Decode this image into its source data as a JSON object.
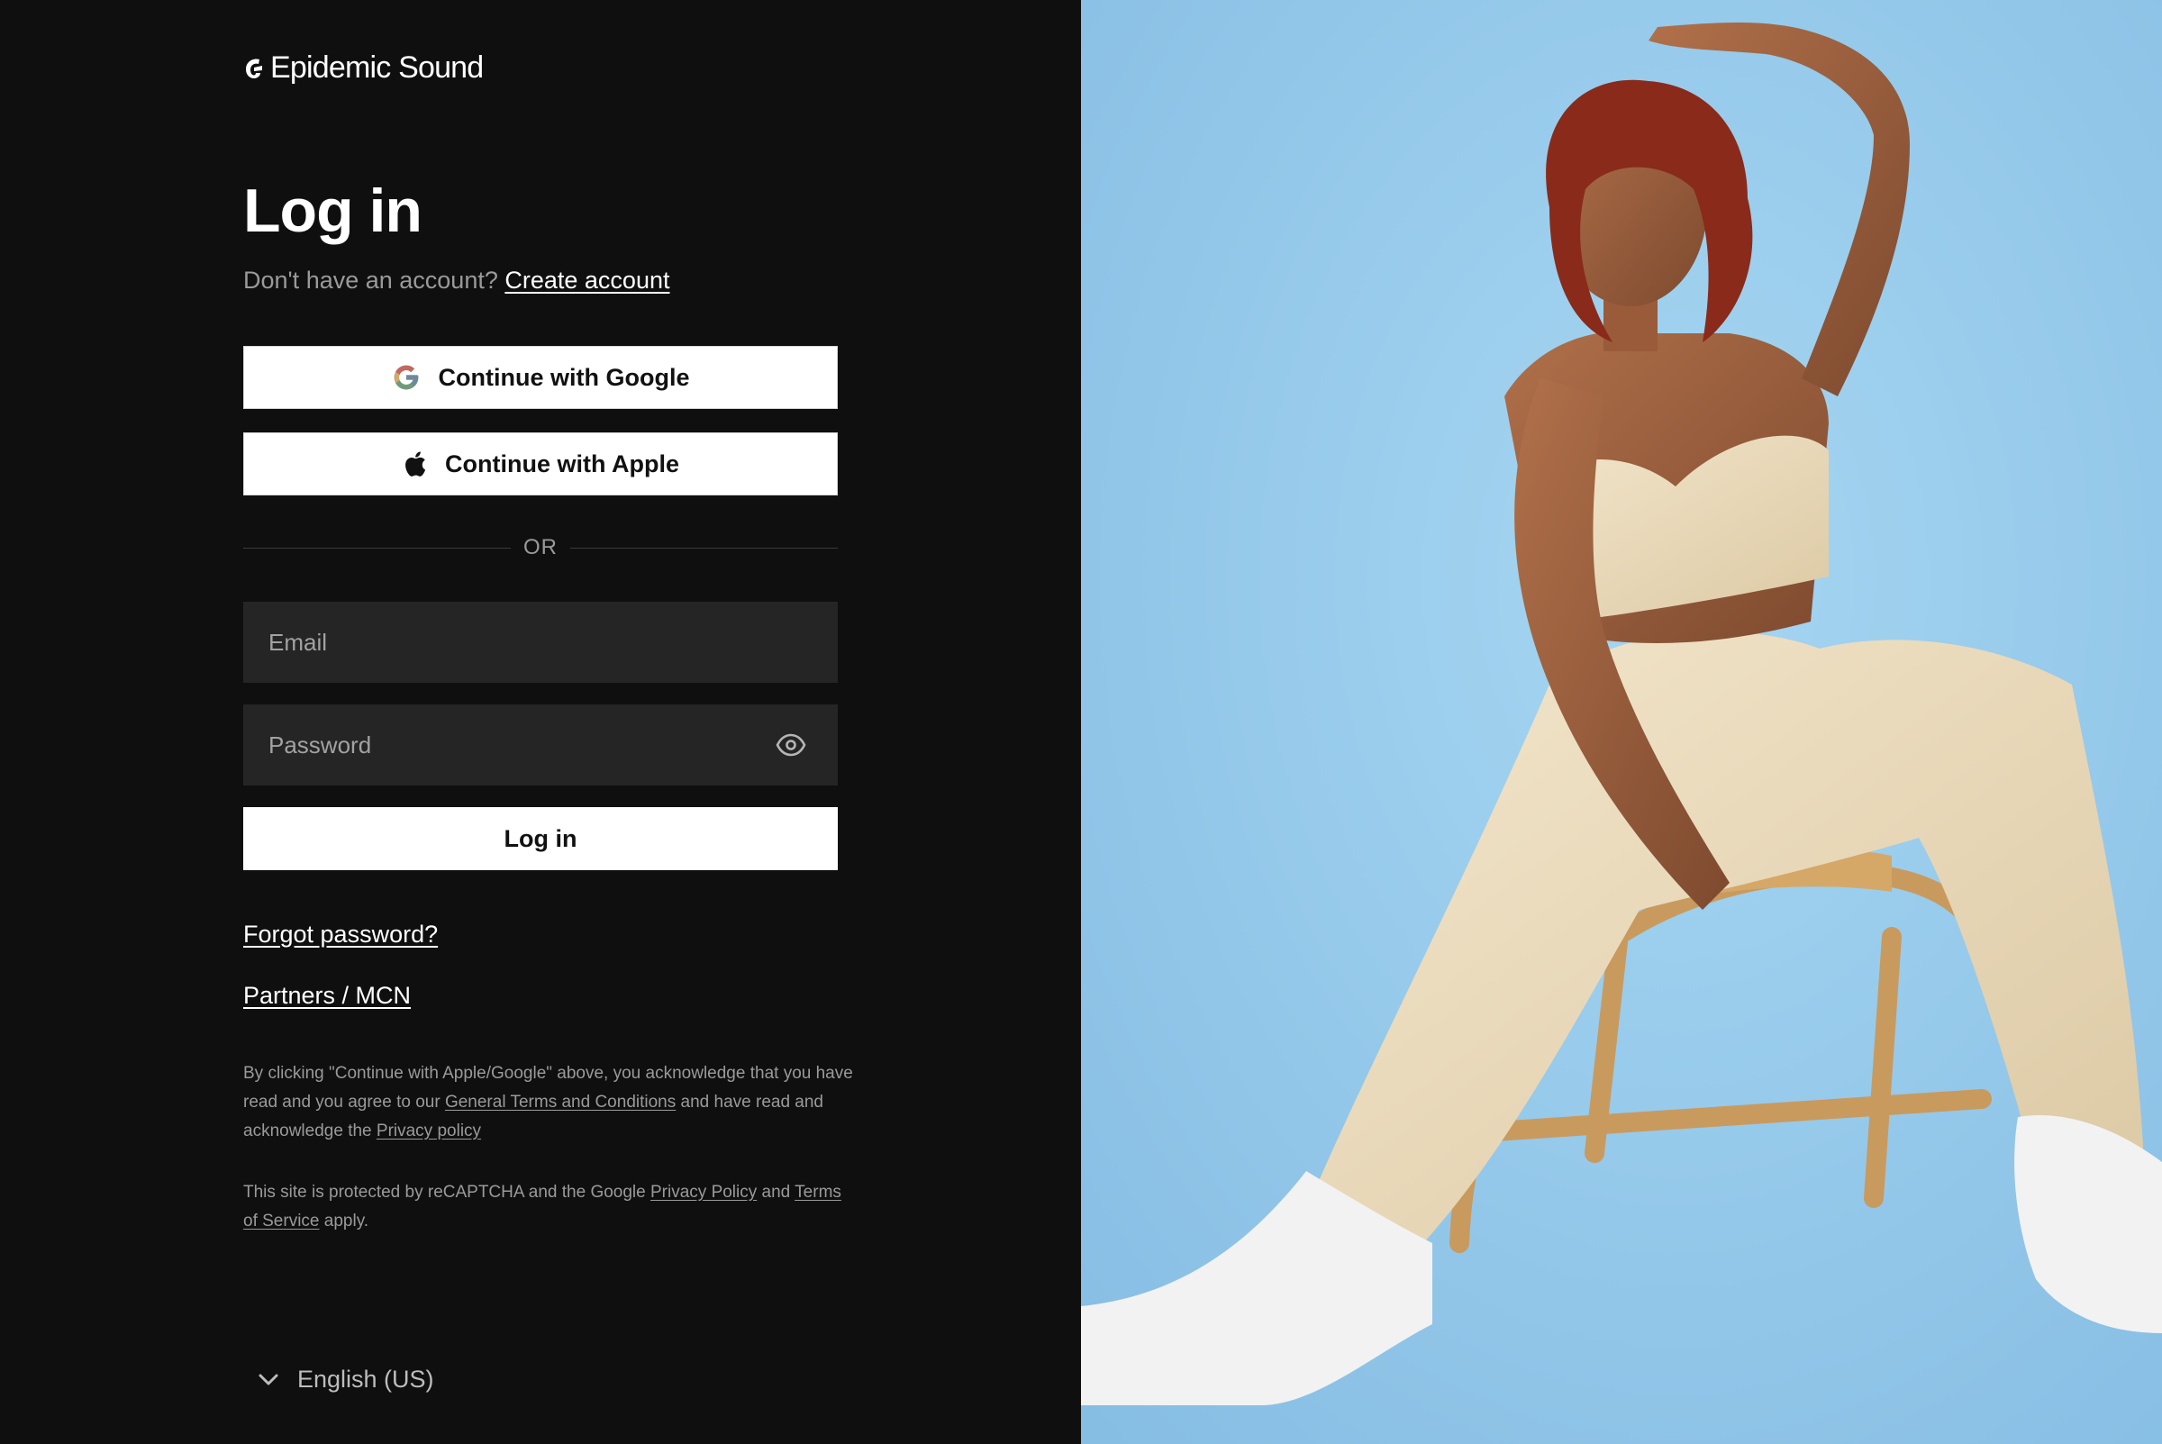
{
  "brand": {
    "name": "Epidemic Sound"
  },
  "login": {
    "title": "Log in",
    "no_account_text": "Don't have an account?",
    "create_account_link": "Create account",
    "google_button": "Continue with Google",
    "apple_button": "Continue with Apple",
    "divider_text": "OR",
    "email_placeholder": "Email",
    "email_value": "",
    "password_placeholder": "Password",
    "password_value": "",
    "submit_button": "Log in",
    "forgot_password_link": "Forgot password?",
    "partners_link": "Partners / MCN"
  },
  "legal": {
    "consent_part1": "By clicking \"Continue with Apple/Google\" above, you acknowledge that you have read and you agree to our",
    "terms_link": "General Terms and Conditions",
    "consent_part2": "and have read and acknowledge the",
    "privacy_link": "Privacy policy",
    "recaptcha_part1": "This site is protected by reCAPTCHA and the Google",
    "recaptcha_privacy_link": "Privacy Policy",
    "recaptcha_part2": "and",
    "recaptcha_terms_link": "Terms of Service",
    "recaptcha_part3": "apply."
  },
  "language": {
    "selected": "English (US)"
  },
  "icons": {
    "logo": "epidemic-sound-logo-icon",
    "google": "google-icon",
    "apple": "apple-icon",
    "password_toggle": "eye-icon",
    "language_toggle": "chevron-down-icon"
  },
  "colors": {
    "left_background": "#0f0f0f",
    "input_background": "#252525",
    "button_background": "#ffffff",
    "muted_text": "#9a9a9a",
    "photo_background": "#9ccdec"
  }
}
